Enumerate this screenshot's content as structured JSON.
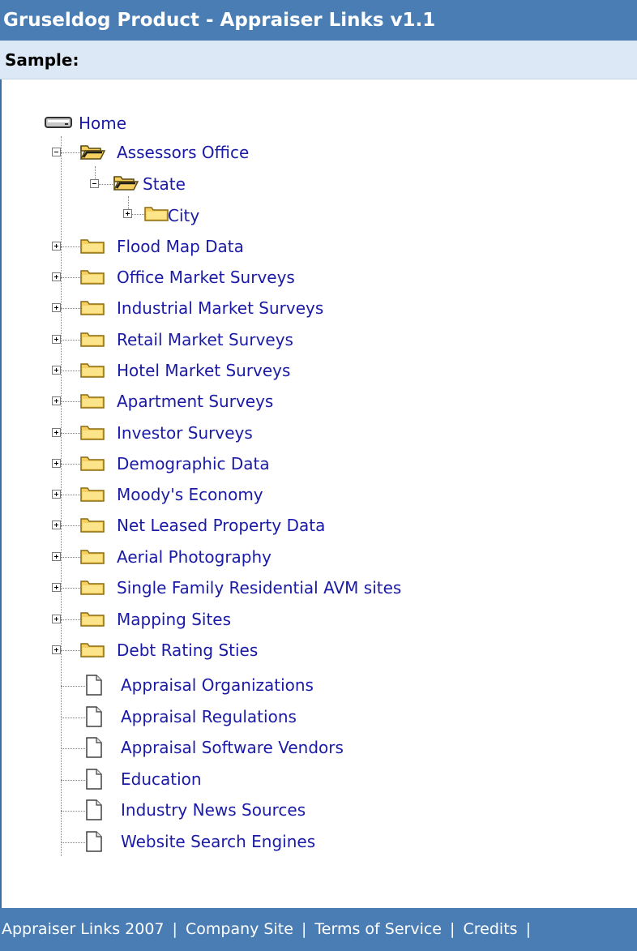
{
  "header": {
    "title": "Gruseldog Product - Appraiser Links v1.1",
    "sample_label": "Sample:"
  },
  "tree": {
    "root": "Home",
    "assessors": "Assessors Office",
    "state": "State",
    "city": "City",
    "folders": [
      "Flood Map Data",
      "Office Market Surveys",
      "Industrial Market Surveys",
      "Retail Market Surveys",
      "Hotel Market Surveys",
      "Apartment Surveys",
      "Investor Surveys",
      "Demographic Data",
      "Moody's Economy",
      "Net Leased Property Data",
      "Aerial Photography",
      "Single Family Residential AVM sites",
      "Mapping Sites",
      "Debt Rating Sties"
    ],
    "documents": [
      "Appraisal Organizations",
      "Appraisal Regulations",
      "Appraisal Software Vendors",
      "Education",
      "Industry News Sources",
      "Website Search Engines"
    ]
  },
  "footer": {
    "copyright": "Appraiser Links 2007",
    "company": "Company Site",
    "terms": "Terms of Service",
    "credits": "Credits"
  },
  "colors": {
    "header_bg": "#4a7db4",
    "sample_bg": "#dce8f5",
    "link": "#1a1aa6"
  }
}
